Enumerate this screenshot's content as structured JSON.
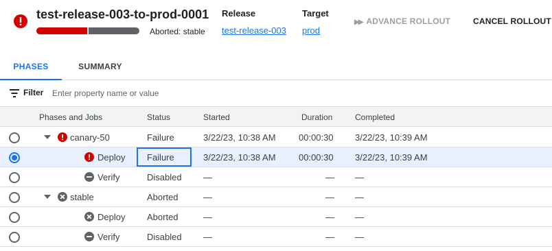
{
  "header": {
    "title": "test-release-003-to-prod-0001",
    "status_icon": "error-icon",
    "progress": {
      "status_text": "Aborted: stable",
      "failed_fraction": 0.5
    },
    "release_label": "Release",
    "release_value": "test-release-003",
    "target_label": "Target",
    "target_value": "prod",
    "advance_label": "ADVANCE ROLLOUT",
    "cancel_label": "CANCEL ROLLOUT",
    "colors": {
      "error": "#d50000",
      "accent": "#1a73e8",
      "disabled": "#9aa0a6"
    }
  },
  "tabs": [
    {
      "label": "PHASES",
      "active": true
    },
    {
      "label": "SUMMARY",
      "active": false
    }
  ],
  "filter": {
    "label": "Filter",
    "placeholder": "Enter property name or value"
  },
  "table": {
    "columns": [
      "Phases and Jobs",
      "Status",
      "Started",
      "Duration",
      "Completed"
    ],
    "rows": [
      {
        "name": "canary-50",
        "icon": "error-icon",
        "expandable": true,
        "status": "Failure",
        "started": "3/22/23, 10:38 AM",
        "duration": "00:00:30",
        "completed": "3/22/23, 10:39 AM",
        "selected": false
      },
      {
        "name": "Deploy",
        "icon": "error-icon",
        "expandable": false,
        "status": "Failure",
        "started": "3/22/23, 10:38 AM",
        "duration": "00:00:30",
        "completed": "3/22/23, 10:39 AM",
        "selected": true
      },
      {
        "name": "Verify",
        "icon": "disabled-icon",
        "expandable": false,
        "status": "Disabled",
        "started": "—",
        "duration": "—",
        "completed": "—",
        "selected": false
      },
      {
        "name": "stable",
        "icon": "aborted-icon",
        "expandable": true,
        "status": "Aborted",
        "started": "—",
        "duration": "—",
        "completed": "—",
        "selected": false
      },
      {
        "name": "Deploy",
        "icon": "aborted-icon",
        "expandable": false,
        "status": "Aborted",
        "started": "—",
        "duration": "—",
        "completed": "—",
        "selected": false
      },
      {
        "name": "Verify",
        "icon": "disabled-icon",
        "expandable": false,
        "status": "Disabled",
        "started": "—",
        "duration": "—",
        "completed": "—",
        "selected": false
      }
    ]
  }
}
